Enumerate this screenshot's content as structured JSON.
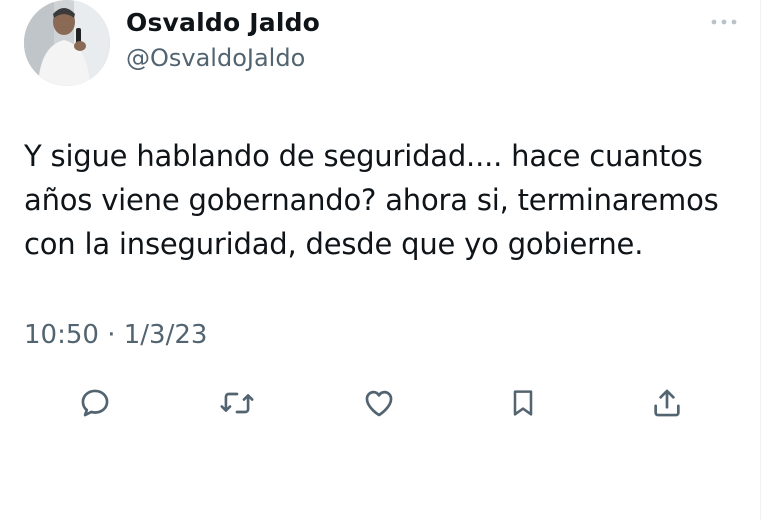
{
  "user": {
    "display_name": "Osvaldo Jaldo",
    "handle": "@OsvaldoJaldo",
    "avatar_icon": "avatar-photo"
  },
  "tweet": {
    "lines": [
      "Y sigue hablando de seguridad.... hace cuantos",
      "años viene gobernando? ahora si, terminaremos",
      "con la inseguridad, desde que yo gobierne."
    ],
    "timestamp": "10:50 · 1/3/23"
  },
  "actions": [
    "reply-icon",
    "retweet-icon",
    "like-icon",
    "bookmark-icon",
    "share-icon"
  ],
  "colors": {
    "text": "#0f1419",
    "secondary": "#536471",
    "icon": "#536471"
  }
}
